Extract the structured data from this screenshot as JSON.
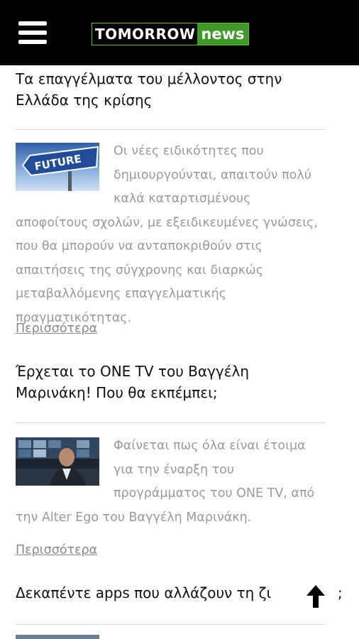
{
  "header": {
    "logo_main": "TOMORROW",
    "logo_accent": "news",
    "bg_color": "#000000",
    "accent_color": "#3f9a2a"
  },
  "articles": [
    {
      "title_line1": "Τα επαγγέλματα του μέλλοντος στην",
      "title_line2": "Ελλάδα της κρίσης",
      "thumb_text": "FUTURE",
      "excerpt": "Οι νέες ειδικότητες που δημιουργούνται, απαιτούν πολύ καλά καταρτισμένους αποφοίτους σχολών, με εξειδικευμένες γνώσεις, που θα μπορούν να ανταποκριθούν στις απαιτήσεις της σύγχρονης και διαρκώς μεταβαλλόμενης επαγγελματικής πραγματικότητας.",
      "more_label": "Περισσότερα"
    },
    {
      "title_line1": "Έρχεται το ONE TV του Βαγγέλη",
      "title_line2": "Μαρινάκη! Που θα εκπέμπει;",
      "excerpt": "Φαίνεται πως όλα είναι έτοιμα για την έναρξη του προγράμματος του ONE TV, από την Alter Ego του Βαγγέλη Μαρινάκη.",
      "more_label": "Περισσότερα"
    },
    {
      "title_line1": "Δεκαπέντε apps που αλλάζουν τη ζι",
      "title_end": ";"
    }
  ],
  "colors": {
    "headline": "#111111",
    "excerpt": "#9a9a9a",
    "divider": "#d8d8d8"
  }
}
